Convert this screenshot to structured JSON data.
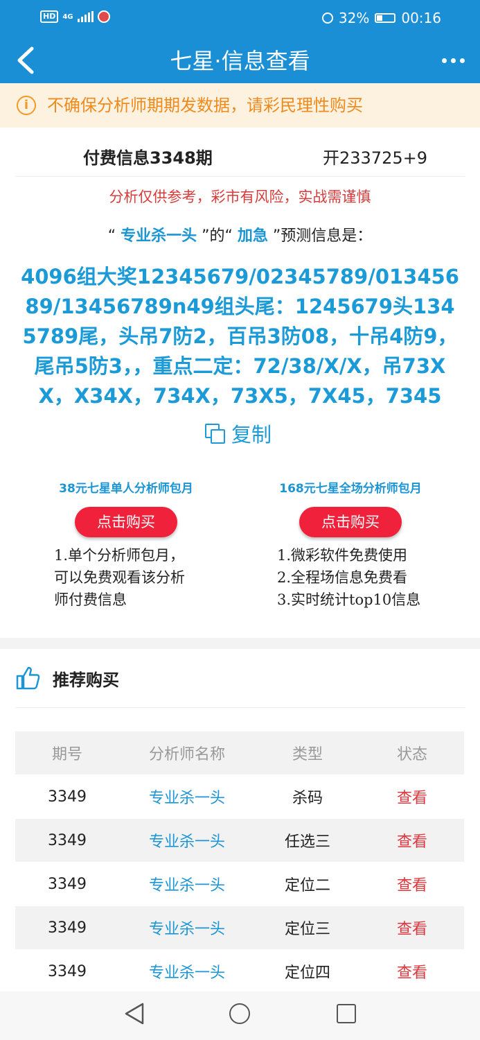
{
  "status_bar": {
    "hd": "HD",
    "network": "4G",
    "battery": "32%",
    "time": "00:16"
  },
  "header": {
    "title": "七星·信息查看"
  },
  "warning": {
    "text": "不确保分析师期期发数据，请彩民理性购买",
    "icon": "info-icon"
  },
  "info": {
    "period": "付费信息3348期",
    "result": "开233725+9",
    "disclaimer": "分析仅供参考，彩市有风险，实战需谨慎",
    "predict_open1": "“ ",
    "analyst": "专业杀一头",
    "predict_mid": " ”的“ ",
    "category": "加急",
    "predict_end": " ”预测信息是：",
    "content": "4096组大奖12345679/02345789/01345689/13456789n49组头尾：1245679头1345789尾，头吊7防2，百吊3防08，十吊4防9，尾吊5防3，，重点二定：72/38/X/X，吊73XX，X34X，734X，73X5，7X45，7345",
    "copy_label": "复制"
  },
  "packages": [
    {
      "title": "38元七星单人分析师包月",
      "button": "点击购买",
      "lines": [
        "1.单个分析师包月，",
        "可以免费观看该分析",
        "师付费信息"
      ]
    },
    {
      "title": "168元七星全场分析师包月",
      "button": "点击购买",
      "lines": [
        "1.微彩软件免费使用",
        "2.全程场信息免费看",
        "3.实时统计top10信息"
      ]
    }
  ],
  "recommend": {
    "title": "推荐购买",
    "columns": [
      "期号",
      "分析师名称",
      "类型",
      "状态"
    ],
    "rows": [
      {
        "period": "3349",
        "analyst": "专业杀一头",
        "type": "杀码",
        "status": "查看"
      },
      {
        "period": "3349",
        "analyst": "专业杀一头",
        "type": "任选三",
        "status": "查看"
      },
      {
        "period": "3349",
        "analyst": "专业杀一头",
        "type": "定位二",
        "status": "查看"
      },
      {
        "period": "3349",
        "analyst": "专业杀一头",
        "type": "定位三",
        "status": "查看"
      },
      {
        "period": "3349",
        "analyst": "专业杀一头",
        "type": "定位四",
        "status": "查看"
      }
    ]
  },
  "colors": {
    "brand_blue": "#1b8fd6",
    "buy_red": "#f0213a",
    "warning_orange": "#f08a1c"
  }
}
